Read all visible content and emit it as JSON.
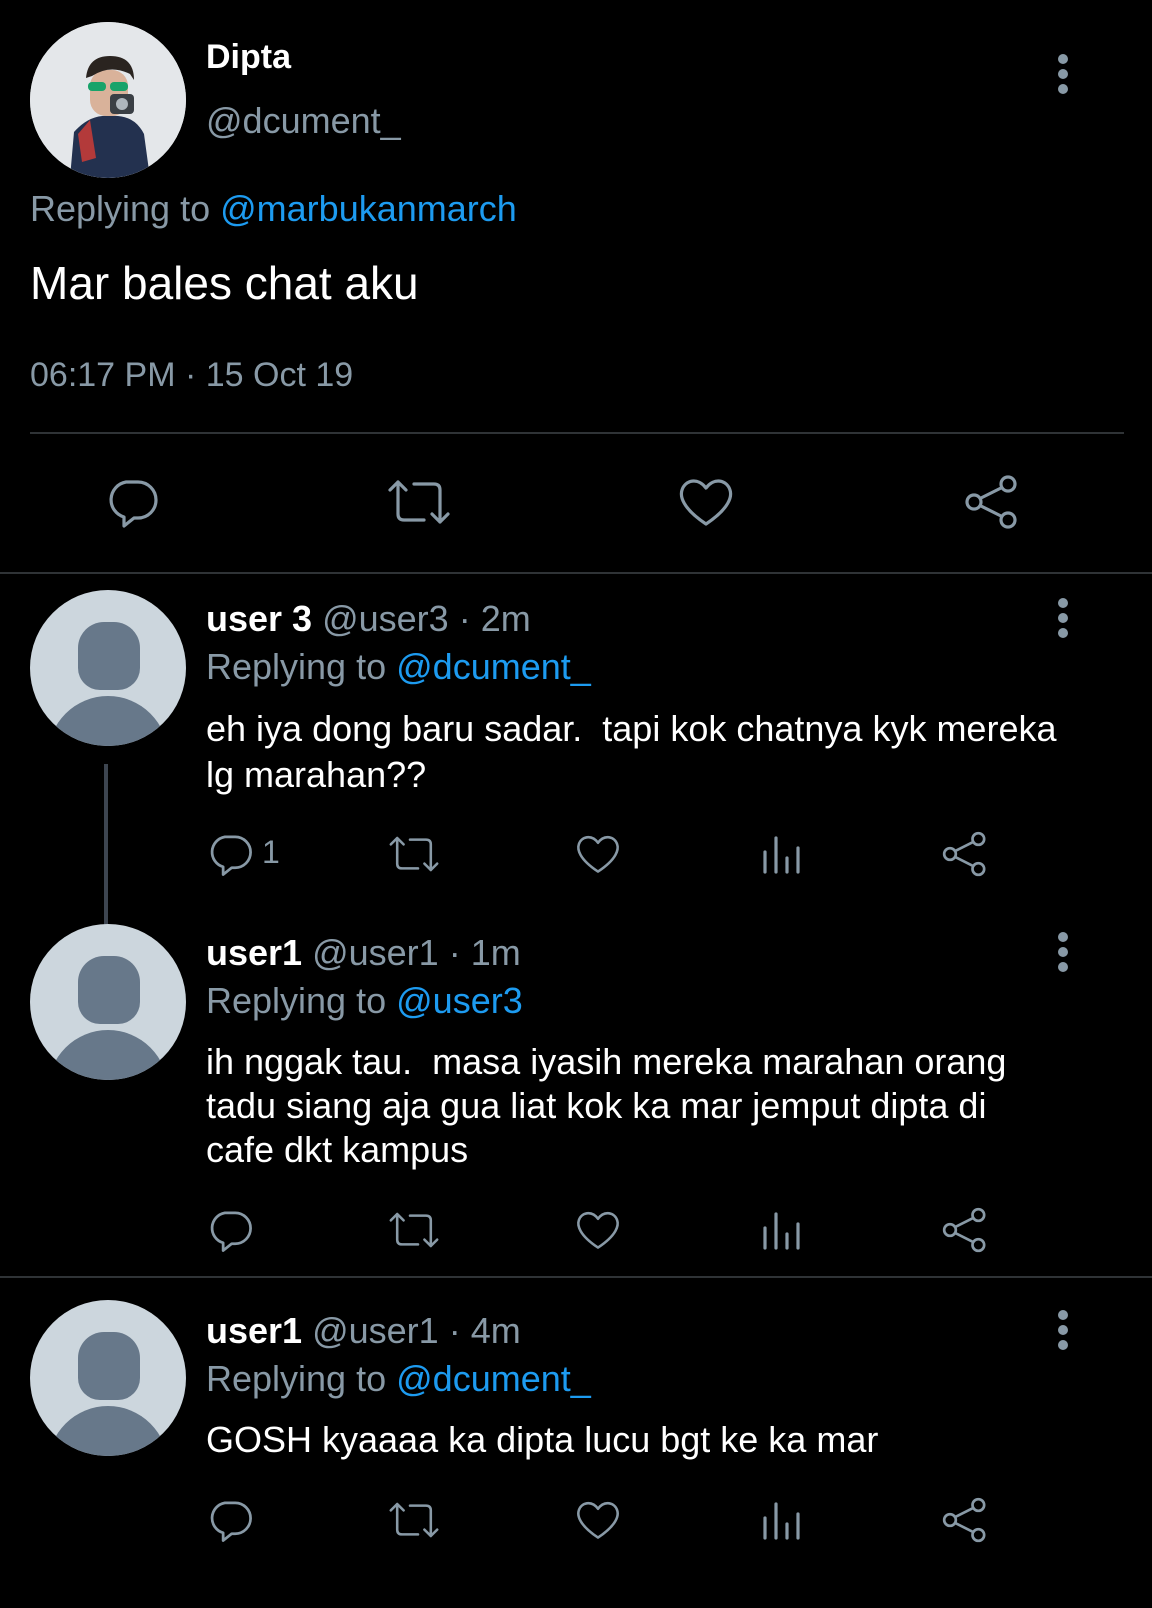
{
  "main_tweet": {
    "name": "Dipta",
    "handle": "@dcument_",
    "replying_prefix": "Replying to",
    "replying_to": "@marbukanmarch",
    "text": "Mar bales chat aku",
    "timestamp": "06:17 PM · 15 Oct 19"
  },
  "replies": [
    {
      "name": "user 3",
      "handle": "@user3",
      "time": "· 2m",
      "replying_prefix": "Replying to",
      "replying_to": "@dcument_",
      "text_lines": [
        "eh iya dong baru sadar.  tapi kok chatnya kyk mereka",
        "lg marahan??"
      ],
      "reply_count": "1"
    },
    {
      "name": "user1",
      "handle": "@user1",
      "time": "· 1m",
      "replying_prefix": "Replying to",
      "replying_to": "@user3",
      "text_lines": [
        "ih nggak tau.  masa iyasih mereka marahan orang",
        "tadu siang aja gua liat kok ka mar jemput dipta di",
        "cafe dkt kampus"
      ]
    },
    {
      "name": "user1",
      "handle": "@user1",
      "time": "· 4m",
      "replying_prefix": "Replying to",
      "replying_to": "@dcument_",
      "text_lines": [
        "GOSH kyaaaa ka dipta lucu bgt ke ka mar"
      ]
    }
  ],
  "colors": {
    "background": "#000000",
    "muted": "#8899a6",
    "link": "#1d9bf0",
    "divider": "#2f3336",
    "avatar_bg": "#ccd6dd",
    "avatar_fg": "#67788a"
  },
  "icons": [
    "reply-icon",
    "retweet-icon",
    "like-icon",
    "analytics-icon",
    "share-icon",
    "more-options-icon"
  ]
}
